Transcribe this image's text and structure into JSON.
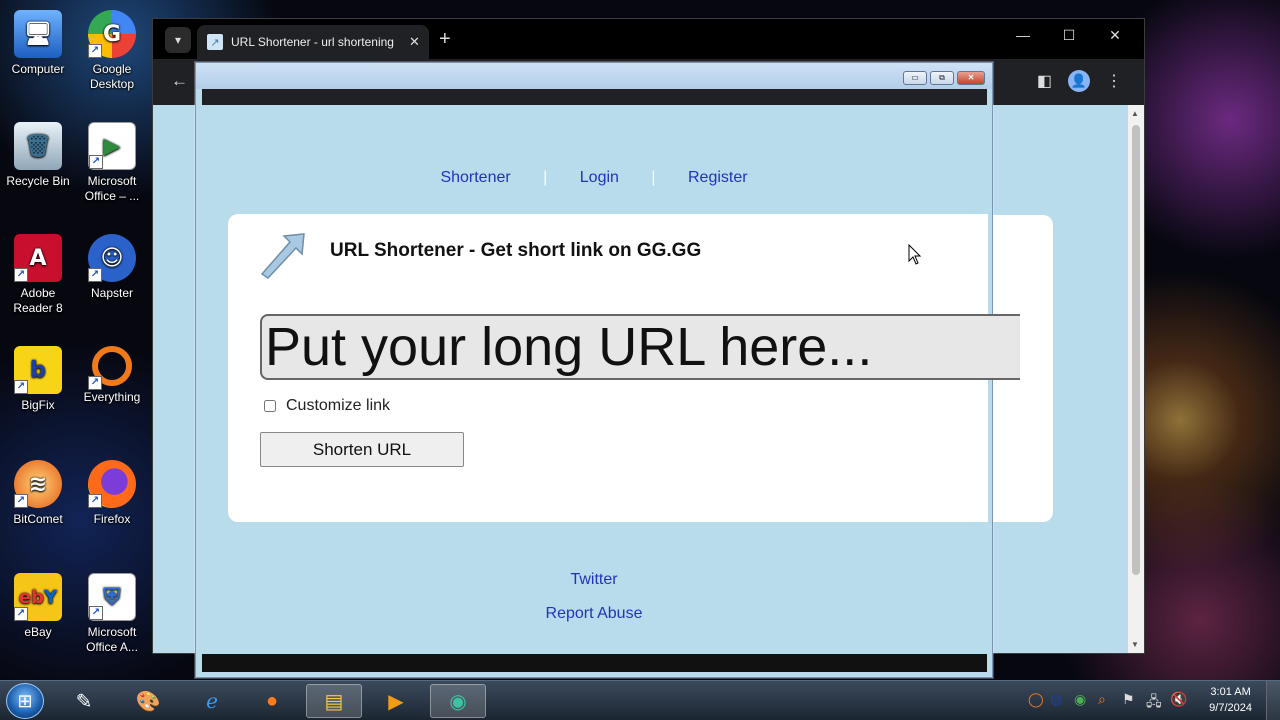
{
  "desktop": {
    "icons": [
      {
        "label": "Computer",
        "icon": "computer-icon"
      },
      {
        "label": "Google Desktop",
        "icon": "google-desktop-icon"
      },
      {
        "label": "Recycle Bin",
        "icon": "recycle-bin-icon"
      },
      {
        "label": "Microsoft Office – ...",
        "icon": "office-icon"
      },
      {
        "label": "Adobe Reader 8",
        "icon": "adobe-reader-icon"
      },
      {
        "label": "Napster",
        "icon": "napster-icon"
      },
      {
        "label": "BigFix",
        "icon": "bigfix-icon"
      },
      {
        "label": "Everything",
        "icon": "everything-icon"
      },
      {
        "label": "BitComet",
        "icon": "bitcomet-icon"
      },
      {
        "label": "Firefox",
        "icon": "firefox-icon"
      },
      {
        "label": "eBay",
        "icon": "ebay-icon"
      },
      {
        "label": "Microsoft Office A...",
        "icon": "office-icon"
      }
    ]
  },
  "browser": {
    "tab_title": "URL Shortener - url shortening",
    "new_tab": "+",
    "tab_close": "✕",
    "minimize": "—",
    "maximize": "☐",
    "close": "✕",
    "back": "←"
  },
  "page": {
    "nav": {
      "shortener": "Shortener",
      "login": "Login",
      "register": "Register",
      "separator": "|"
    },
    "title": "URL Shortener - Get short link on GG.GG",
    "url_placeholder": "Put your long URL here...",
    "customize_label": "Customize link",
    "shorten_button": "Shorten URL",
    "footer": {
      "twitter": "Twitter",
      "report_abuse": "Report Abuse"
    }
  },
  "taskbar": {
    "clock_time": "3:01 AM",
    "clock_date": "9/7/2024"
  },
  "colors": {
    "page_bg": "#b8dcec",
    "link": "#2233bb",
    "desktop_bg": "#06070f"
  }
}
